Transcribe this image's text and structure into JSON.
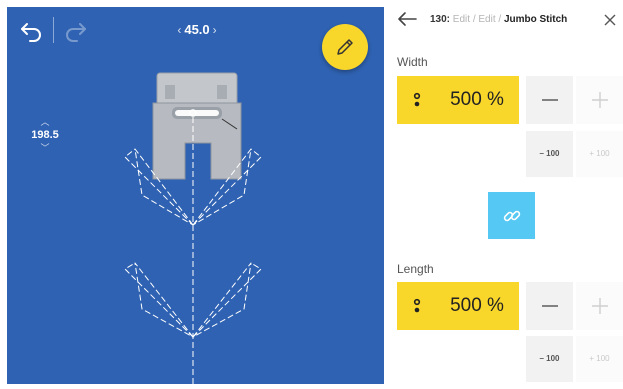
{
  "canvas": {
    "angle_value": "45.0",
    "position_value": "198.5",
    "icons": {
      "undo": "undo-icon",
      "redo": "redo-icon",
      "edit": "pencil-icon",
      "angle_prev": "chevron-left-icon",
      "angle_next": "chevron-right-icon",
      "position_up": "chevron-up-icon",
      "position_down": "chevron-down-icon"
    },
    "colors": {
      "background": "#2f62b2",
      "edit_button": "#f8d62a"
    }
  },
  "header": {
    "stitch_number": "130:",
    "breadcrumb_1": "Edit",
    "breadcrumb_separator": "/",
    "breadcrumb_2": "Edit",
    "breadcrumb_current": "Jumbo Stitch",
    "icons": {
      "back": "arrow-left-icon",
      "close": "close-icon"
    }
  },
  "width": {
    "label": "Width",
    "value": "500 %",
    "decrement_small_label": "– 100",
    "increment_small_label": "+ 100"
  },
  "length": {
    "label": "Length",
    "value": "500 %",
    "decrement_small_label": "– 100",
    "increment_small_label": "+ 100"
  },
  "link": {
    "icon": "link-icon",
    "color": "#55c8f3"
  },
  "colors": {
    "value_box": "#f8d62a",
    "button_bg": "#f2f2f2"
  }
}
